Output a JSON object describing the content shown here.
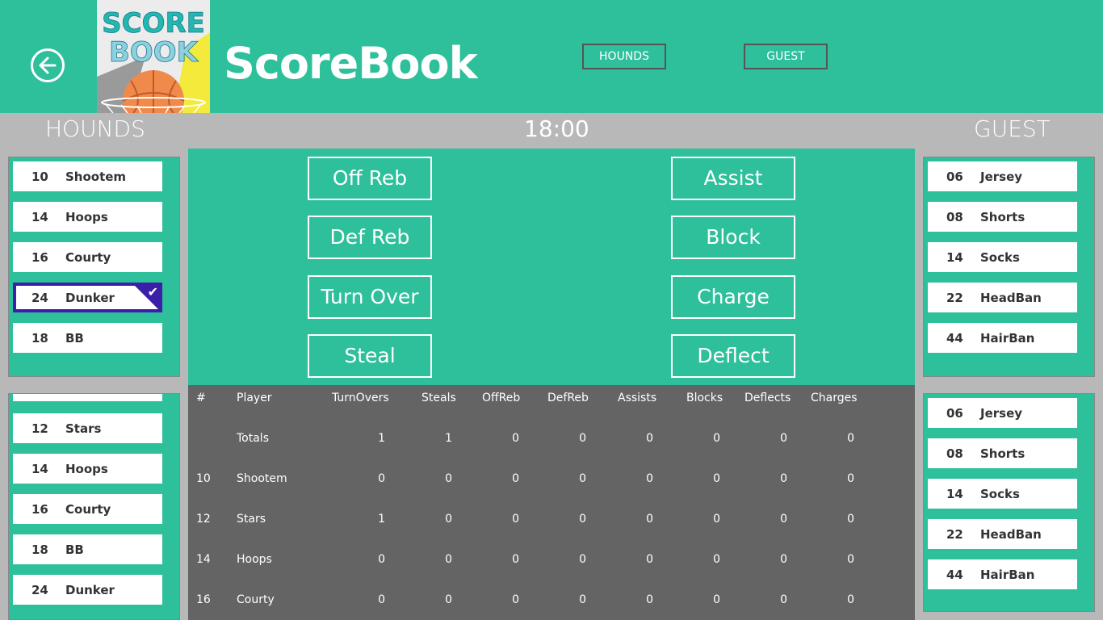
{
  "header": {
    "app_title": "ScoreBook",
    "logo_text_line1": "SCORE",
    "logo_text_line2": "BOOK",
    "home_team_button": "HOUNDS",
    "guest_team_button": "GUEST"
  },
  "scoreboard": {
    "home_team": "HOUNDS",
    "clock": "18:00",
    "guest_team": "GUEST"
  },
  "home_roster_top": [
    {
      "num": "10",
      "name": "Shootem",
      "selected": false
    },
    {
      "num": "14",
      "name": "Hoops",
      "selected": false
    },
    {
      "num": "16",
      "name": "Courty",
      "selected": false
    },
    {
      "num": "24",
      "name": "Dunker",
      "selected": true
    },
    {
      "num": "18",
      "name": "BB",
      "selected": false
    }
  ],
  "home_roster_bottom": [
    {
      "num": "12",
      "name": "Stars"
    },
    {
      "num": "14",
      "name": "Hoops"
    },
    {
      "num": "16",
      "name": "Courty"
    },
    {
      "num": "18",
      "name": "BB"
    },
    {
      "num": "24",
      "name": "Dunker"
    }
  ],
  "guest_roster_top": [
    {
      "num": "06",
      "name": "Jersey"
    },
    {
      "num": "08",
      "name": "Shorts"
    },
    {
      "num": "14",
      "name": "Socks"
    },
    {
      "num": "22",
      "name": "HeadBan"
    },
    {
      "num": "44",
      "name": "HairBan"
    }
  ],
  "guest_roster_bottom": [
    {
      "num": "06",
      "name": "Jersey"
    },
    {
      "num": "08",
      "name": "Shorts"
    },
    {
      "num": "14",
      "name": "Socks"
    },
    {
      "num": "22",
      "name": "HeadBan"
    },
    {
      "num": "44",
      "name": "HairBan"
    }
  ],
  "actions": {
    "left": [
      "Off Reb",
      "Def Reb",
      "Turn Over",
      "Steal"
    ],
    "right": [
      "Assist",
      "Block",
      "Charge",
      "Deflect"
    ]
  },
  "stats_table": {
    "headers": [
      "#",
      "Player",
      "TurnOvers",
      "Steals",
      "OffReb",
      "DefReb",
      "Assists",
      "Blocks",
      "Deflects",
      "Charges"
    ],
    "rows": [
      {
        "num": "",
        "player": "Totals",
        "values": [
          "1",
          "1",
          "0",
          "0",
          "0",
          "0",
          "0",
          "0"
        ]
      },
      {
        "num": "10",
        "player": "Shootem",
        "values": [
          "0",
          "0",
          "0",
          "0",
          "0",
          "0",
          "0",
          "0"
        ]
      },
      {
        "num": "12",
        "player": "Stars",
        "values": [
          "1",
          "0",
          "0",
          "0",
          "0",
          "0",
          "0",
          "0"
        ]
      },
      {
        "num": "14",
        "player": "Hoops",
        "values": [
          "0",
          "0",
          "0",
          "0",
          "0",
          "0",
          "0",
          "0"
        ]
      },
      {
        "num": "16",
        "player": "Courty",
        "values": [
          "0",
          "0",
          "0",
          "0",
          "0",
          "0",
          "0",
          "0"
        ]
      }
    ]
  },
  "colors": {
    "accent": "#2ebf9b",
    "background": "#b8b8b8",
    "table_bg": "#646464",
    "selection": "#3b1fa8"
  }
}
